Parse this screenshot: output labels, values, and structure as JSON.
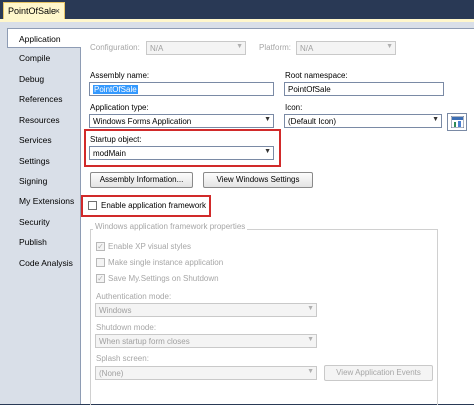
{
  "document_tab": {
    "title": "PointOfSale",
    "close": "×"
  },
  "sidebar": {
    "items": [
      {
        "label": "Application",
        "active": true
      },
      {
        "label": "Compile"
      },
      {
        "label": "Debug"
      },
      {
        "label": "References"
      },
      {
        "label": "Resources"
      },
      {
        "label": "Services"
      },
      {
        "label": "Settings"
      },
      {
        "label": "Signing"
      },
      {
        "label": "My Extensions"
      },
      {
        "label": "Security"
      },
      {
        "label": "Publish"
      },
      {
        "label": "Code Analysis"
      }
    ]
  },
  "header": {
    "configuration_label": "Configuration:",
    "configuration_value": "N/A",
    "platform_label": "Platform:",
    "platform_value": "N/A"
  },
  "form": {
    "assembly_name_label": "Assembly name:",
    "assembly_name_value": "PointOfSale",
    "root_namespace_label": "Root namespace:",
    "root_namespace_value": "PointOfSale",
    "application_type_label": "Application type:",
    "application_type_value": "Windows Forms Application",
    "icon_label": "Icon:",
    "icon_value": "(Default Icon)",
    "startup_object_label": "Startup object:",
    "startup_object_value": "modMain",
    "assembly_info_button": "Assembly Information...",
    "view_windows_settings_button": "View Windows Settings",
    "enable_framework_label": "Enable application framework"
  },
  "framework": {
    "title": "Windows application framework properties",
    "xp_styles_label": "Enable XP visual styles",
    "single_instance_label": "Make single instance application",
    "save_settings_label": "Save My.Settings on Shutdown",
    "auth_mode_label": "Authentication mode:",
    "auth_mode_value": "Windows",
    "shutdown_mode_label": "Shutdown mode:",
    "shutdown_mode_value": "When startup form closes",
    "splash_label": "Splash screen:",
    "splash_value": "(None)",
    "view_events_button": "View Application Events"
  },
  "colors": {
    "highlight": "#d12a2a",
    "tab_active": "#fff7cc",
    "frame": "#293955"
  }
}
